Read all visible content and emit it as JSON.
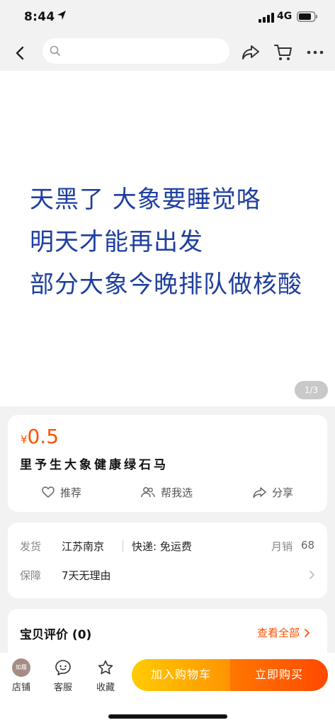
{
  "status_bar": {
    "time": "8:44",
    "network": "4G"
  },
  "search": {
    "placeholder": ""
  },
  "hero": {
    "lines": [
      "天黑了 大象要睡觉咯",
      "明天才能再出发",
      "部分大象今晚排队做核酸"
    ],
    "page_indicator": "1/3",
    "text_color": "#1e3f9e"
  },
  "product": {
    "currency": "¥",
    "price": "0.5",
    "title": "里予生大象健康绿石马",
    "price_color": "#ff5000"
  },
  "actions": [
    {
      "label": "推荐",
      "icon": "heart-icon"
    },
    {
      "label": "帮我选",
      "icon": "people-icon"
    },
    {
      "label": "分享",
      "icon": "share-icon"
    }
  ],
  "shipping": {
    "ship_label": "发货",
    "origin": "江苏南京",
    "express": "快递: 免运费",
    "monthly_sales_label": "月销",
    "monthly_sales": "68",
    "guarantee_label": "保障",
    "guarantee": "7天无理由"
  },
  "reviews": {
    "title": "宝贝评价 (0)",
    "view_all": "查看全部"
  },
  "bottom_bar": {
    "shop_avatar_text": "如履",
    "shop": "店铺",
    "service": "客服",
    "favorite": "收藏",
    "add_to_cart": "加入购物车",
    "buy_now": "立即购买"
  }
}
